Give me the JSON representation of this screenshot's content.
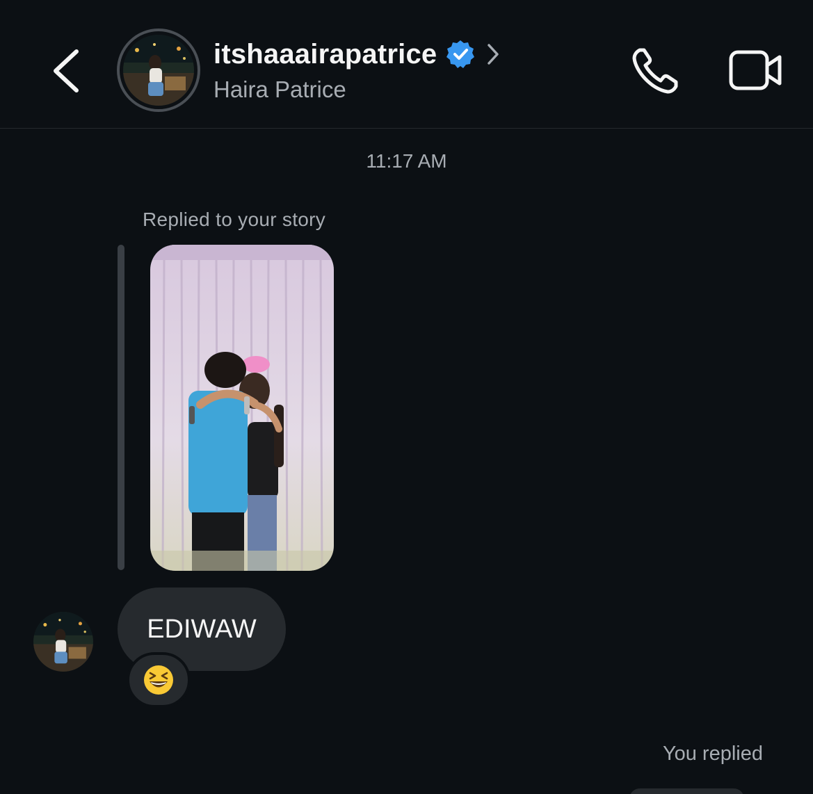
{
  "header": {
    "username": "itshaaairapatrice",
    "full_name": "Haira Patrice",
    "verified": true,
    "verified_color": "#3897f0",
    "icons": {
      "back": "chevron-left-icon",
      "profile": "chevron-right-icon",
      "call": "phone-icon",
      "video": "video-camera-icon"
    }
  },
  "chat": {
    "timestamp": "11:17 AM",
    "story_reply": {
      "label": "Replied to your story"
    },
    "message": {
      "text": "EDIWAW",
      "reaction": "😆"
    },
    "you_replied_label": "You replied"
  },
  "colors": {
    "background": "#0c1014",
    "bubble": "#262a2e",
    "secondary_text": "#a8adb3",
    "accent_verified": "#3897f0"
  }
}
